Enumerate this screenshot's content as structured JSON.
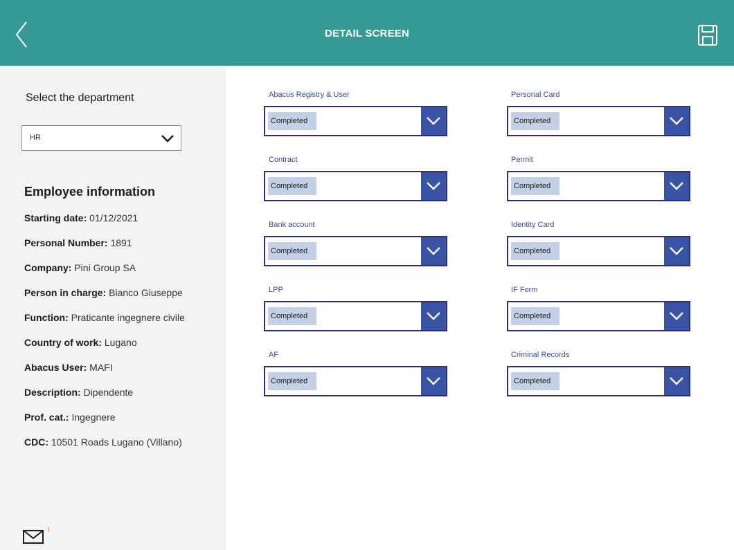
{
  "header": {
    "title": "DETAIL SCREEN",
    "back_icon": "chevron-left-icon",
    "save_icon": "floppy-disk-icon",
    "color": "#359a96"
  },
  "sidebar": {
    "department_label": "Select the department",
    "department_value": "HR",
    "employee_title": "Employee information",
    "info": [
      {
        "label": "Starting date:",
        "value": "01/12/2021"
      },
      {
        "label": "Personal Number:",
        "value": "1891"
      },
      {
        "label": "Company:",
        "value": "Pini Group SA"
      },
      {
        "label": "Person in charge:",
        "value": "Bianco Giuseppe"
      },
      {
        "label": "Function:",
        "value": "Praticante ingegnere civile"
      },
      {
        "label": "Country of work:",
        "value": "Lugano"
      },
      {
        "label": "Abacus User:",
        "value": "MAFI"
      },
      {
        "label": "Description:",
        "value": "Dipendente"
      },
      {
        "label": "Prof. cat.:",
        "value": "Ingegnere"
      },
      {
        "label": "CDC:",
        "value": "10501 Roads Lugano (Villano)"
      }
    ],
    "mail_badge": "1"
  },
  "fields": [
    {
      "label": "Abacus Registry & User",
      "value": "Completed"
    },
    {
      "label": "Personal Card",
      "value": "Completed"
    },
    {
      "label": "Contract",
      "value": "Completed"
    },
    {
      "label": "Permit",
      "value": "Completed"
    },
    {
      "label": "Bank account",
      "value": "Completed"
    },
    {
      "label": "Identity Card",
      "value": "Completed"
    },
    {
      "label": "LPP",
      "value": "Completed"
    },
    {
      "label": "IF Form",
      "value": "Completed"
    },
    {
      "label": "AF",
      "value": "Completed"
    },
    {
      "label": "Criminal Records",
      "value": "Completed"
    }
  ]
}
